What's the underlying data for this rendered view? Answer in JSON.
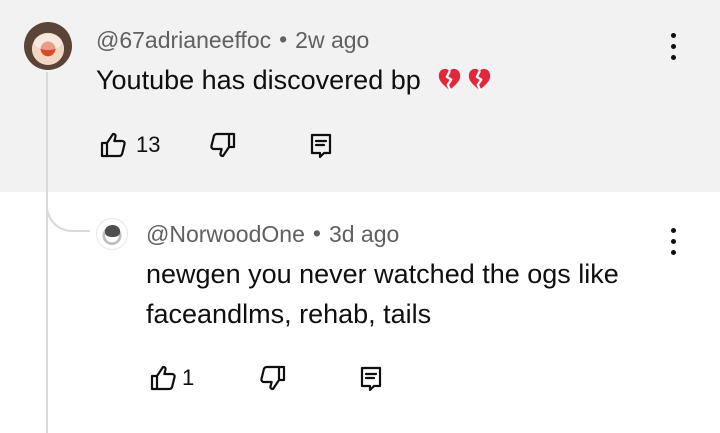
{
  "thread": {
    "comment": {
      "author": "@67adrianeeffoc",
      "separator": "•",
      "time": "2w ago",
      "text": "Youtube has discovered bp",
      "emojis": [
        "broken-heart-icon",
        "broken-heart-icon"
      ],
      "like_count": "13",
      "icons": {
        "like": "thumb-up-icon",
        "dislike": "thumb-down-icon",
        "reply": "reply-comment-icon",
        "more": "more-vertical-icon"
      }
    },
    "reply": {
      "author": "@NorwoodOne",
      "separator": "•",
      "time": "3d ago",
      "text_lines": [
        "newgen you never watched the ogs like",
        "faceandlms, rehab, tails"
      ],
      "like_count": "1",
      "icons": {
        "like": "thumb-up-icon",
        "dislike": "thumb-down-icon",
        "reply": "reply-comment-icon",
        "more": "more-vertical-icon"
      }
    }
  },
  "colors": {
    "highlight_background": "#f2f2f2",
    "meta_text": "#606060",
    "thread_line": "#d9d9d9",
    "emoji_red": "#e1283b"
  }
}
